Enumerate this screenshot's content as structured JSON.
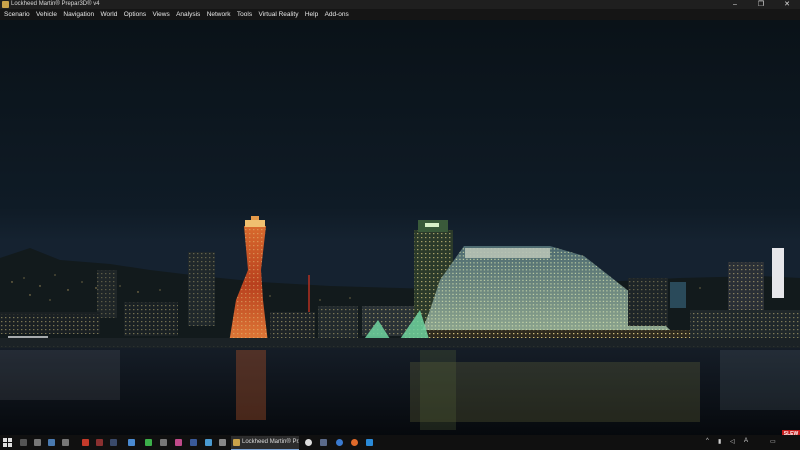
{
  "window": {
    "title": "Lockheed Martin® Prepar3D® v4",
    "controls": {
      "minimize": "–",
      "maximize": "❐",
      "close": "✕"
    }
  },
  "menu": [
    "Scenario",
    "Vehicle",
    "Navigation",
    "World",
    "Options",
    "Views",
    "Analysis",
    "Network",
    "Tools",
    "Virtual Reality",
    "Help",
    "Add-ons"
  ],
  "overlay": {
    "slew_badge": "SLEW",
    "slew_color": "#c41a1a"
  },
  "scene": {
    "description_icon": "night-harbor-cityscape"
  },
  "taskbar": {
    "active_app_label": "Lockheed Martin® Pr...",
    "pinned_icons": [
      "search-icon",
      "task-view-icon",
      "app-icon",
      "app-icon",
      "app-icon",
      "app-icon",
      "app-icon",
      "app-icon",
      "app-icon",
      "app-icon",
      "app-icon",
      "app-icon",
      "app-icon",
      "app-icon",
      "app-icon",
      "app-icon",
      "app-icon",
      "app-icon"
    ],
    "running_icons": [
      "app-icon",
      "app-icon",
      "edge-icon"
    ],
    "tray_icons": [
      "chevron-up-icon",
      "network-icon",
      "volume-icon",
      "ime-icon",
      "clock",
      "notification-icon"
    ],
    "ime_label": "A",
    "colors": {
      "accent": "#7aa3d6"
    }
  }
}
